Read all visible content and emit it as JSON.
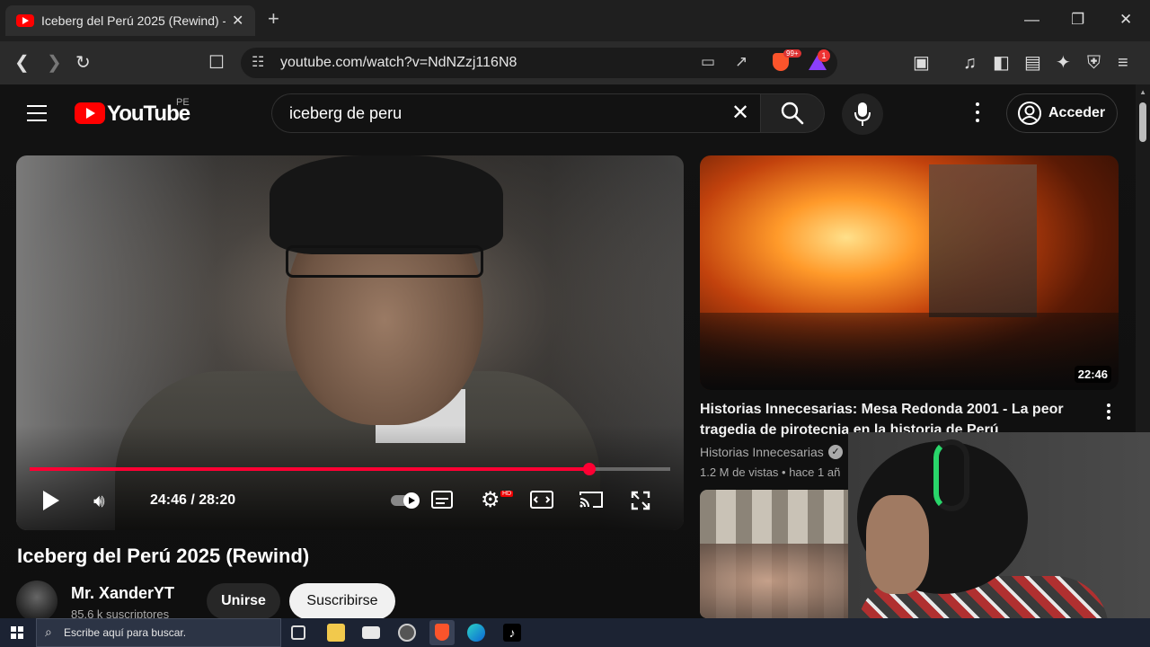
{
  "browser": {
    "tab_title": "Iceberg del Perú 2025 (Rewind) -",
    "tab_close": "✕",
    "new_tab": "+",
    "url": "youtube.com/watch?v=NdNZzj116N8",
    "shield_badge": "99+",
    "rewards_badge": "1",
    "window_buttons": [
      "—",
      "❐",
      "✕"
    ]
  },
  "youtube": {
    "wordmark": "YouTube",
    "region": "PE",
    "search_value": "iceberg de peru",
    "signin_label": "Acceder"
  },
  "player": {
    "time": "24:46 / 28:20",
    "progress_fraction": 0.874,
    "hd_badge": "HD"
  },
  "video": {
    "title": "Iceberg del Perú 2025 (Rewind)",
    "channel": "Mr. XanderYT",
    "subscribers": "85.6 k suscriptores",
    "join_label": "Unirse",
    "subscribe_label": "Suscribirse"
  },
  "recommendations": [
    {
      "title": "Historias Innecesarias: Mesa Redonda 2001 - La peor tragedia de pirotecnia en la historia de Perú",
      "channel": "Historias Innecesarias",
      "meta": "1.2 M de vistas • hace 1 añ",
      "duration": "22:46"
    }
  ],
  "taskbar": {
    "search_placeholder": "Escribe aquí para buscar."
  },
  "colors": {
    "accent_red": "#ff0033",
    "youtube_red": "#ff0000",
    "page_bg": "#0f0f0f",
    "taskbar_bg": "#1c2333"
  },
  "icons": [
    "youtube-favicon",
    "back-icon",
    "forward-icon",
    "reload-icon",
    "bookmark-icon",
    "site-settings-icon",
    "cast-page-icon",
    "share-icon",
    "brave-shield-icon",
    "brave-rewards-icon",
    "screenshot-icon",
    "music-icon",
    "sidebar-icon",
    "wallet-icon",
    "leo-icon",
    "vpn-icon",
    "menu-icon",
    "hamburger-icon",
    "clear-icon",
    "search-icon",
    "mic-icon",
    "kebab-icon",
    "account-icon",
    "play-icon",
    "volume-icon",
    "autoplay-icon",
    "subtitles-icon",
    "settings-icon",
    "theater-icon",
    "cast-icon",
    "fullscreen-icon",
    "verified-icon",
    "windows-start-icon",
    "task-view-icon",
    "file-explorer-icon",
    "mail-icon",
    "brave-taskbar-icon",
    "edge-icon",
    "tiktok-icon"
  ]
}
